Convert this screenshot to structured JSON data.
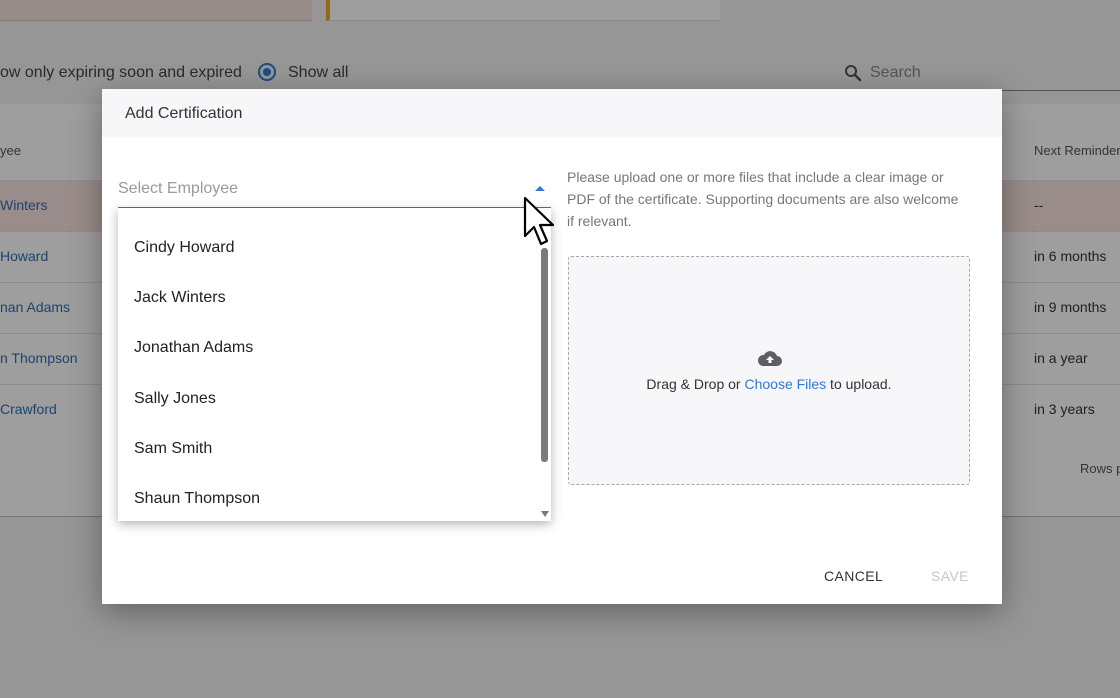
{
  "background": {
    "filter_text": "ow only expiring soon and expired",
    "show_all_label": "Show all",
    "search_placeholder": "Search",
    "column_employee": "yee",
    "column_next_reminder": "Next Reminder",
    "rows": [
      {
        "name": "Winters",
        "reminder": "--"
      },
      {
        "name": " Howard",
        "reminder": "in 6 months"
      },
      {
        "name": "nan Adams",
        "reminder": "in 9 months"
      },
      {
        "name": "n Thompson",
        "reminder": "in a year"
      },
      {
        "name": " Crawford",
        "reminder": "in 3 years"
      }
    ],
    "rows_per_page": "Rows p"
  },
  "dialog": {
    "title": "Add Certification",
    "select_label": "Select Employee",
    "upload_instructions": "Please upload one or more files that include a clear image or PDF of the certificate. Supporting documents are also welcome if relevant.",
    "drop_prefix": "Drag & Drop or ",
    "choose_files": "Choose Files",
    "drop_suffix": " to upload.",
    "cancel_label": "CANCEL",
    "save_label": "SAVE"
  },
  "dropdown": {
    "options": [
      "Cindy Howard",
      "Jack Winters",
      "Jonathan Adams",
      "Sally Jones",
      "Sam Smith",
      "Shaun Thompson"
    ]
  },
  "colors": {
    "accent": "#2f7ad6",
    "highlight_row": "#f8e3df",
    "disabled_text": "#c6c6c6"
  },
  "icons": {
    "search": "search-icon",
    "upload": "cloud-upload-icon",
    "cursor": "mouse-pointer-icon",
    "dropdown": "chevron-up-icon"
  }
}
